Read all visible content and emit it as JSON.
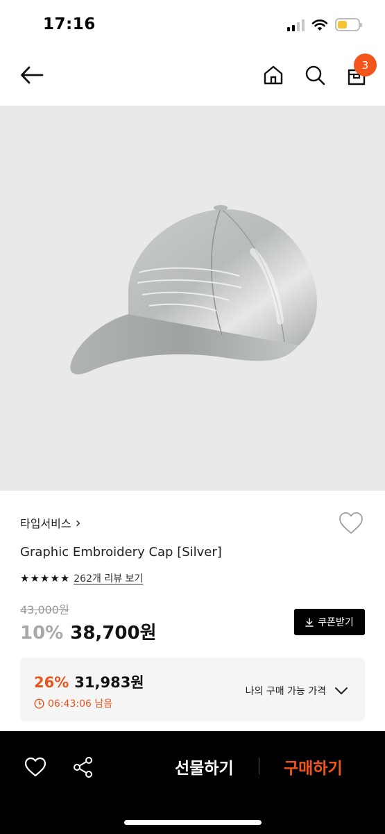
{
  "status_bar": {
    "time": "17:16",
    "icons": [
      "signal-icon",
      "wifi-icon",
      "battery-icon"
    ],
    "battery_color": "#f6c431"
  },
  "nav": {
    "icons": [
      "back-arrow-icon",
      "home-icon",
      "search-icon",
      "cart-icon"
    ],
    "cart_badge": "3",
    "badge_color": "#f2561d"
  },
  "product": {
    "image": "silver-cap-photo",
    "brand": "타입서비스",
    "brand_chevron": "›",
    "name": "Graphic Embroidery Cap [Silver]",
    "rating_stars": 5,
    "review_link": "262개 리뷰 보기",
    "original_price": "43,000원",
    "discount": "10%",
    "price": "38,700원",
    "coupon_button": "쿠폰받기"
  },
  "best_price": {
    "discount": "26%",
    "price": "31,983원",
    "timer": "06:43:06 남음",
    "label": "나의 구매 가능 가격",
    "accent_color": "#e8541c"
  },
  "bottom_bar": {
    "icons": [
      "heart-icon",
      "share-icon"
    ],
    "gift_label": "선물하기",
    "buy_label": "구매하기",
    "buy_color": "#f2561d"
  }
}
